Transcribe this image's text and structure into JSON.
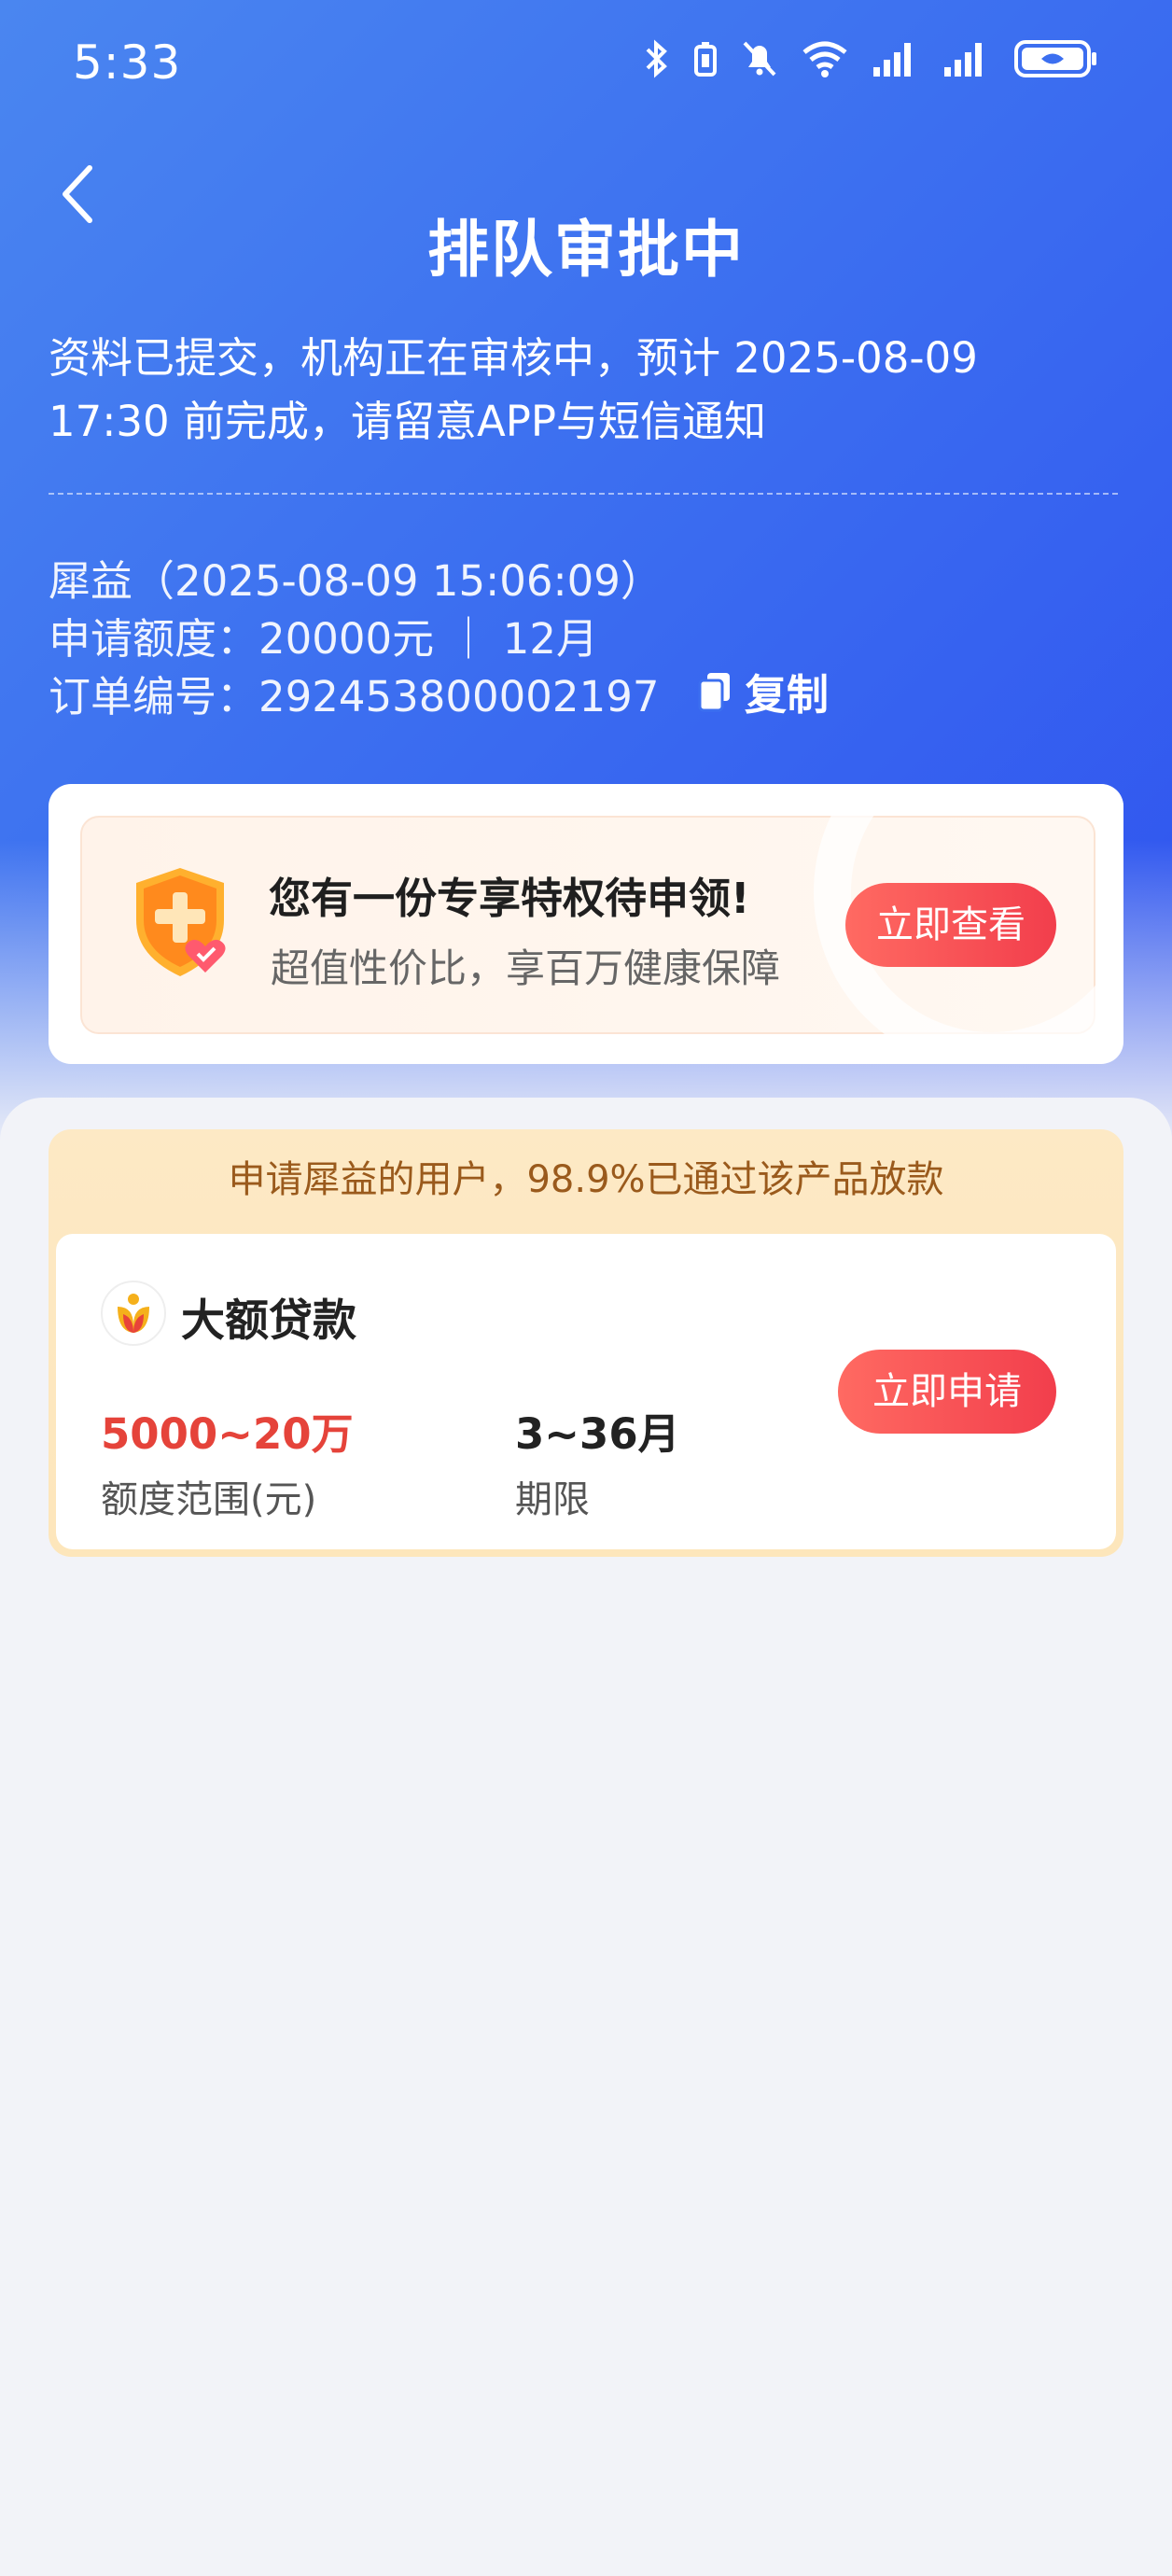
{
  "status_bar": {
    "time": "5:33"
  },
  "header": {
    "title": "排队审批中"
  },
  "description": {
    "line1": "资料已提交，机构正在审核中，预计 2025-08-09",
    "line2": "17:30 前完成，请留意APP与短信通知"
  },
  "order": {
    "name_line": "犀益（2025-08-09 15:06:09）",
    "amount_line": "申请额度：20000元 ｜ 12月",
    "number_line": "订单编号：292453800002197",
    "copy_label": "复制"
  },
  "promo": {
    "title": "您有一份专享特权待申领!",
    "subtitle": "超值性价比，享百万健康保障",
    "button": "立即查看"
  },
  "product": {
    "banner": "申请犀益的用户，98.9%已通过该产品放款",
    "name": "大额贷款",
    "amount_value": "5000~20万",
    "amount_label": "额度范围(元)",
    "term_value": "3~36月",
    "term_label": "期限",
    "button": "立即申请"
  },
  "icons": [
    "bluetooth-icon",
    "battery-saver-icon",
    "mute-bell-icon",
    "wifi-icon",
    "signal-icon",
    "signal-icon-2",
    "battery-icon",
    "back-arrow-icon",
    "copy-icon",
    "shield-heart-icon",
    "product-logo-icon"
  ],
  "colors": {
    "accent_red": "#f23e4c",
    "hero_blue": "#3c6ff0",
    "amount_red": "#e5433a"
  }
}
